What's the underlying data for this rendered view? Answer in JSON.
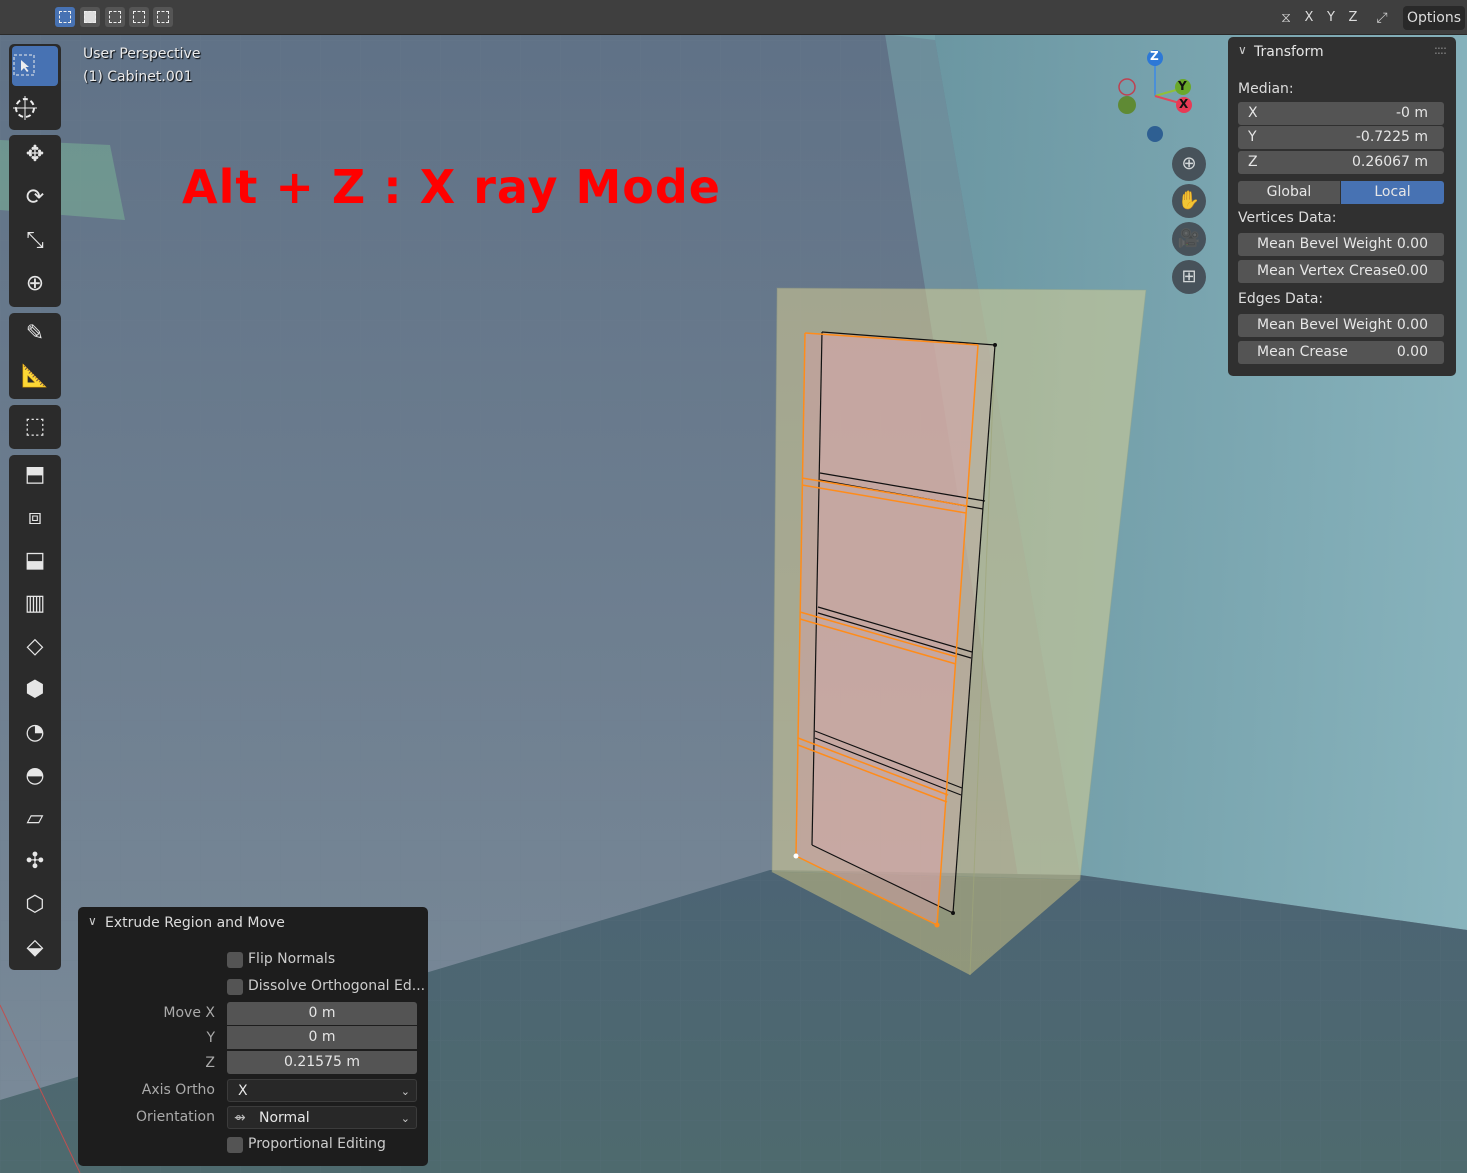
{
  "header": {
    "axis_x": "X",
    "axis_y": "Y",
    "axis_z": "Z",
    "options_label": "Options"
  },
  "viewport": {
    "view_name": "User Perspective",
    "object_name": "(1) Cabinet.001",
    "caption": "Alt + Z : X ray Mode"
  },
  "gizmo": {
    "z": "Z",
    "y": "Y",
    "x": "X"
  },
  "transform_panel": {
    "title": "Transform",
    "median_label": "Median:",
    "fields": [
      {
        "key": "X",
        "value": "-0 m"
      },
      {
        "key": "Y",
        "value": "-0.7225 m"
      },
      {
        "key": "Z",
        "value": "0.26067 m"
      }
    ],
    "global_label": "Global",
    "local_label": "Local",
    "active_space": "Local",
    "vertices_label": "Vertices Data:",
    "vertices_fields": [
      {
        "key": "Mean Bevel Weight",
        "value": "0.00"
      },
      {
        "key": "Mean Vertex Crease",
        "value": "0.00"
      }
    ],
    "edges_label": "Edges Data:",
    "edges_fields": [
      {
        "key": "Mean Bevel Weight",
        "value": "0.00"
      },
      {
        "key": "Mean Crease",
        "value": "0.00"
      }
    ]
  },
  "operator_panel": {
    "title": "Extrude Region and Move",
    "flip_normals": "Flip Normals",
    "dissolve": "Dissolve Orthogonal Ed...",
    "move_x_label": "Move X",
    "move_x": "0 m",
    "y_label": "Y",
    "move_y": "0 m",
    "z_label": "Z",
    "move_z": "0.21575 m",
    "axis_ortho_label": "Axis Ortho",
    "axis_ortho_value": "X",
    "orientation_label": "Orientation",
    "orientation_value": "Normal",
    "proportional": "Proportional Editing"
  },
  "colors": {
    "accent": "#4772b3",
    "caption": "#ff0000",
    "selection": "#ff8c1a",
    "panel": "#303030"
  }
}
